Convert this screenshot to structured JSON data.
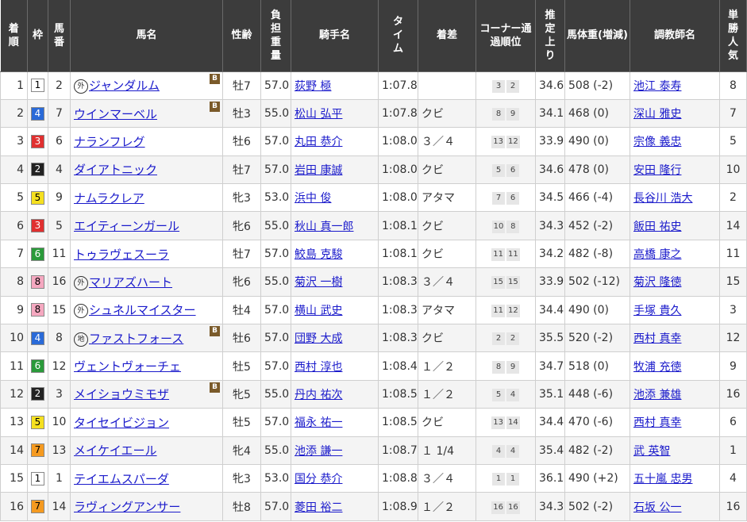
{
  "headers": {
    "rank": "着順",
    "waku": "枠",
    "num": "馬番",
    "horse": "馬名",
    "sexage": "性齢",
    "weight": "負担重量",
    "jockey": "騎手名",
    "time": "タイム",
    "margin": "着差",
    "corner": "コーナー通過順位",
    "last3f": "推定上り",
    "bodyweight": "馬体重(増減)",
    "trainer": "調教師名",
    "pop": "単勝人気"
  },
  "colors": {
    "waku1": "#ffffff",
    "waku2": "#222222",
    "waku3": "#e03030",
    "waku4": "#2a6ad8",
    "waku5": "#f5e020",
    "waku6": "#2a9a3a",
    "waku7": "#f59a20",
    "waku8": "#f5a8c0",
    "link": "#1a1acb",
    "header_bg": "#3c3c3c",
    "blinker_badge": "#7a5a2a"
  },
  "rows": [
    {
      "rank": "1",
      "waku": "1",
      "num": "2",
      "badge": "外",
      "horse": "ジャンダルム",
      "blinker": "B",
      "sexage": "牡7",
      "weight": "57.0",
      "jockey": "荻野 極",
      "time": "1:07.8",
      "margin": "",
      "corner": [
        "3",
        "2"
      ],
      "last3f": "34.6",
      "bodyweight": "508 (-2)",
      "trainer": "池江 泰寿",
      "pop": "8"
    },
    {
      "rank": "2",
      "waku": "4",
      "num": "7",
      "badge": "",
      "horse": "ウインマーベル",
      "blinker": "B",
      "sexage": "牡3",
      "weight": "55.0",
      "jockey": "松山 弘平",
      "time": "1:07.8",
      "margin": "クビ",
      "corner": [
        "8",
        "9"
      ],
      "last3f": "34.1",
      "bodyweight": "468 (0)",
      "trainer": "深山 雅史",
      "pop": "7"
    },
    {
      "rank": "3",
      "waku": "3",
      "num": "6",
      "badge": "",
      "horse": "ナランフレグ",
      "blinker": "",
      "sexage": "牡6",
      "weight": "57.0",
      "jockey": "丸田 恭介",
      "time": "1:08.0",
      "margin": "３／４",
      "corner": [
        "13",
        "12"
      ],
      "last3f": "33.9",
      "bodyweight": "490 (0)",
      "trainer": "宗像 義忠",
      "pop": "5"
    },
    {
      "rank": "4",
      "waku": "2",
      "num": "4",
      "badge": "",
      "horse": "ダイアトニック",
      "blinker": "",
      "sexage": "牡7",
      "weight": "57.0",
      "jockey": "岩田 康誠",
      "time": "1:08.0",
      "margin": "クビ",
      "corner": [
        "5",
        "6"
      ],
      "last3f": "34.6",
      "bodyweight": "478 (0)",
      "trainer": "安田 隆行",
      "pop": "10"
    },
    {
      "rank": "5",
      "waku": "5",
      "num": "9",
      "badge": "",
      "horse": "ナムラクレア",
      "blinker": "",
      "sexage": "牝3",
      "weight": "53.0",
      "jockey": "浜中 俊",
      "time": "1:08.0",
      "margin": "アタマ",
      "corner": [
        "7",
        "6"
      ],
      "last3f": "34.5",
      "bodyweight": "466 (-4)",
      "trainer": "長谷川 浩大",
      "pop": "2"
    },
    {
      "rank": "6",
      "waku": "3",
      "num": "5",
      "badge": "",
      "horse": "エイティーンガール",
      "blinker": "",
      "sexage": "牝6",
      "weight": "55.0",
      "jockey": "秋山 真一郎",
      "time": "1:08.1",
      "margin": "クビ",
      "corner": [
        "10",
        "8"
      ],
      "last3f": "34.3",
      "bodyweight": "452 (-2)",
      "trainer": "飯田 祐史",
      "pop": "14"
    },
    {
      "rank": "7",
      "waku": "6",
      "num": "11",
      "badge": "",
      "horse": "トゥラヴェスーラ",
      "blinker": "",
      "sexage": "牡7",
      "weight": "57.0",
      "jockey": "鮫島 克駿",
      "time": "1:08.1",
      "margin": "クビ",
      "corner": [
        "11",
        "11"
      ],
      "last3f": "34.2",
      "bodyweight": "482 (-8)",
      "trainer": "高橋 康之",
      "pop": "11"
    },
    {
      "rank": "8",
      "waku": "8",
      "num": "16",
      "badge": "外",
      "horse": "マリアズハート",
      "blinker": "",
      "sexage": "牝6",
      "weight": "55.0",
      "jockey": "菊沢 一樹",
      "time": "1:08.3",
      "margin": "３／４",
      "corner": [
        "15",
        "15"
      ],
      "last3f": "33.9",
      "bodyweight": "502 (-12)",
      "trainer": "菊沢 隆徳",
      "pop": "15"
    },
    {
      "rank": "9",
      "waku": "8",
      "num": "15",
      "badge": "外",
      "horse": "シュネルマイスター",
      "blinker": "",
      "sexage": "牡4",
      "weight": "57.0",
      "jockey": "横山 武史",
      "time": "1:08.3",
      "margin": "アタマ",
      "corner": [
        "11",
        "12"
      ],
      "last3f": "34.4",
      "bodyweight": "490 (0)",
      "trainer": "手塚 貴久",
      "pop": "3"
    },
    {
      "rank": "10",
      "waku": "4",
      "num": "8",
      "badge": "地",
      "horse": "ファストフォース",
      "blinker": "B",
      "sexage": "牡6",
      "weight": "57.0",
      "jockey": "団野 大成",
      "time": "1:08.3",
      "margin": "クビ",
      "corner": [
        "2",
        "2"
      ],
      "last3f": "35.5",
      "bodyweight": "520 (-2)",
      "trainer": "西村 真幸",
      "pop": "12"
    },
    {
      "rank": "11",
      "waku": "6",
      "num": "12",
      "badge": "",
      "horse": "ヴェントヴォーチェ",
      "blinker": "",
      "sexage": "牡5",
      "weight": "57.0",
      "jockey": "西村 淳也",
      "time": "1:08.4",
      "margin": "１／２",
      "corner": [
        "8",
        "9"
      ],
      "last3f": "34.7",
      "bodyweight": "518 (0)",
      "trainer": "牧浦 充徳",
      "pop": "9"
    },
    {
      "rank": "12",
      "waku": "2",
      "num": "3",
      "badge": "",
      "horse": "メイショウミモザ",
      "blinker": "B",
      "sexage": "牝5",
      "weight": "55.0",
      "jockey": "丹内 祐次",
      "time": "1:08.5",
      "margin": "１／２",
      "corner": [
        "5",
        "4"
      ],
      "last3f": "35.1",
      "bodyweight": "448 (-6)",
      "trainer": "池添 兼雄",
      "pop": "16"
    },
    {
      "rank": "13",
      "waku": "5",
      "num": "10",
      "badge": "",
      "horse": "タイセイビジョン",
      "blinker": "",
      "sexage": "牡5",
      "weight": "57.0",
      "jockey": "福永 祐一",
      "time": "1:08.5",
      "margin": "クビ",
      "corner": [
        "13",
        "14"
      ],
      "last3f": "34.4",
      "bodyweight": "470 (-6)",
      "trainer": "西村 真幸",
      "pop": "6"
    },
    {
      "rank": "14",
      "waku": "7",
      "num": "13",
      "badge": "",
      "horse": "メイケイエール",
      "blinker": "",
      "sexage": "牝4",
      "weight": "55.0",
      "jockey": "池添 謙一",
      "time": "1:08.7",
      "margin": "１ 1/4",
      "corner": [
        "4",
        "4"
      ],
      "last3f": "35.4",
      "bodyweight": "482 (-2)",
      "trainer": "武 英智",
      "pop": "1"
    },
    {
      "rank": "15",
      "waku": "1",
      "num": "1",
      "badge": "",
      "horse": "テイエムスパーダ",
      "blinker": "",
      "sexage": "牝3",
      "weight": "53.0",
      "jockey": "国分 恭介",
      "time": "1:08.8",
      "margin": "３／４",
      "corner": [
        "1",
        "1"
      ],
      "last3f": "36.1",
      "bodyweight": "490 (+2)",
      "trainer": "五十嵐 忠男",
      "pop": "4"
    },
    {
      "rank": "16",
      "waku": "7",
      "num": "14",
      "badge": "",
      "horse": "ラヴィングアンサー",
      "blinker": "",
      "sexage": "牡8",
      "weight": "57.0",
      "jockey": "菱田 裕二",
      "time": "1:08.9",
      "margin": "１／２",
      "corner": [
        "16",
        "16"
      ],
      "last3f": "34.3",
      "bodyweight": "502 (-2)",
      "trainer": "石坂 公一",
      "pop": "16"
    }
  ]
}
